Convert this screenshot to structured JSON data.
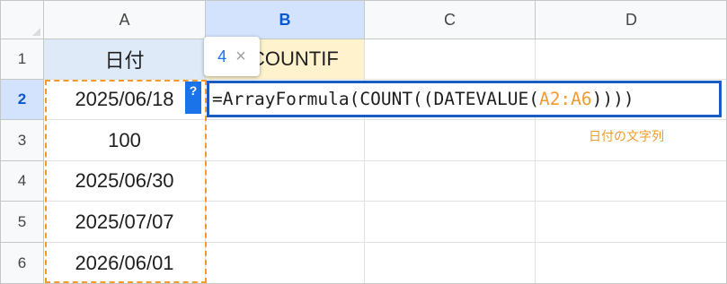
{
  "columns": [
    "A",
    "B",
    "C",
    "D"
  ],
  "rows": [
    "1",
    "2",
    "3",
    "4",
    "5",
    "6"
  ],
  "cells": {
    "a1": "日付",
    "b1": "COUNTIF",
    "a2": "2025/06/18",
    "a3": "100",
    "a4": "2025/06/30",
    "a5": "2025/07/07",
    "a6": "2026/06/01"
  },
  "formula": {
    "prefix": "=ArrayFormula(COUNT((DATEVALUE(",
    "range_ref": "A2:A6",
    "suffix": "))))"
  },
  "tooltip": {
    "value": "4",
    "close": "×"
  },
  "help_icon": "?",
  "annotation": "日付の文字列",
  "colors": {
    "active_header_bg": "#d3e3fd",
    "active_header_text": "#0b57d0",
    "range_highlight": "#f29b2d",
    "formula_border": "#1a5bc4",
    "a1_fill": "#dfeaf8",
    "b1_fill": "#fff2cc"
  }
}
